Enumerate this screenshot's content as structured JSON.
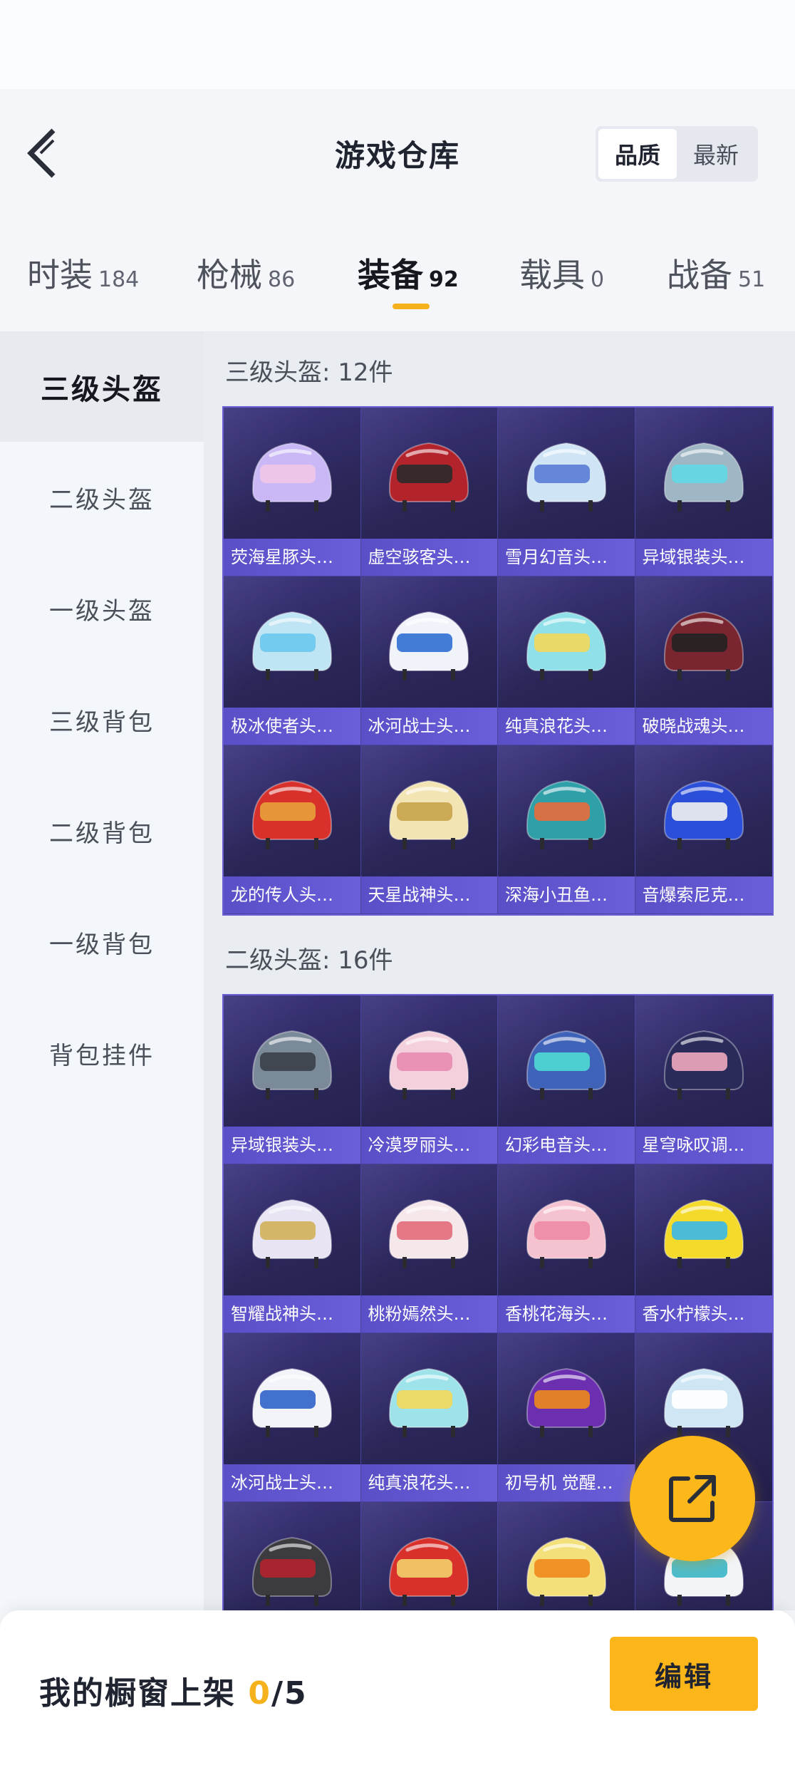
{
  "header": {
    "title": "游戏仓库",
    "sort_options": [
      "品质",
      "最新"
    ],
    "sort_active": "品质"
  },
  "tabs": [
    {
      "label": "时装",
      "count": "184"
    },
    {
      "label": "枪械",
      "count": "86"
    },
    {
      "label": "装备",
      "count": "92"
    },
    {
      "label": "载具",
      "count": "0"
    },
    {
      "label": "战备",
      "count": "51"
    }
  ],
  "active_tab": "装备",
  "sidebar": {
    "items": [
      "三级头盔",
      "二级头盔",
      "一级头盔",
      "三级背包",
      "二级背包",
      "一级背包",
      "背包挂件"
    ],
    "active": "三级头盔"
  },
  "sections": [
    {
      "title": "三级头盔: 12件",
      "items": [
        {
          "name": "荧海星豚头…",
          "color": "#c9b8f5",
          "accent": "#f0c6e8"
        },
        {
          "name": "虚空骇客头…",
          "color": "#b3232c",
          "accent": "#2a2a2a"
        },
        {
          "name": "雪月幻音头…",
          "color": "#cfe5f5",
          "accent": "#5a7bd6"
        },
        {
          "name": "异域银装头…",
          "color": "#9fb6c4",
          "accent": "#5ed9e6"
        },
        {
          "name": "极冰使者头…",
          "color": "#bfe4f4",
          "accent": "#6ac8f0"
        },
        {
          "name": "冰河战士头…",
          "color": "#f0f4fa",
          "accent": "#2f6fd1"
        },
        {
          "name": "纯真浪花头…",
          "color": "#8fe0e8",
          "accent": "#f3d85a"
        },
        {
          "name": "破晓战魂头…",
          "color": "#7a2631",
          "accent": "#222222"
        },
        {
          "name": "龙的传人头…",
          "color": "#d8312c",
          "accent": "#e8a23a"
        },
        {
          "name": "天星战神头…",
          "color": "#f3e4b3",
          "accent": "#c9a34a"
        },
        {
          "name": "深海小丑鱼…",
          "color": "#2f9fa8",
          "accent": "#e86b3a"
        },
        {
          "name": "音爆索尼克…",
          "color": "#2b4fd8",
          "accent": "#f2f2f2"
        }
      ]
    },
    {
      "title": "二级头盔: 16件",
      "items": [
        {
          "name": "异域银装头…",
          "color": "#7b8a99",
          "accent": "#3a3f48"
        },
        {
          "name": "冷漠罗丽头…",
          "color": "#f4d0dd",
          "accent": "#e88bb0"
        },
        {
          "name": "幻彩电音头…",
          "color": "#3f63b8",
          "accent": "#4fd9d4"
        },
        {
          "name": "星穹咏叹调…",
          "color": "#2a2b5a",
          "accent": "#f0a8c0"
        },
        {
          "name": "智耀战神头…",
          "color": "#e8e4f4",
          "accent": "#d2b05a"
        },
        {
          "name": "桃粉嫣然头…",
          "color": "#f6e7ea",
          "accent": "#e36b7a"
        },
        {
          "name": "香桃花海头…",
          "color": "#f5c2cf",
          "accent": "#f08aa5"
        },
        {
          "name": "香水柠檬头…",
          "color": "#f4da2a",
          "accent": "#3ab7e8"
        },
        {
          "name": "冰河战士头…",
          "color": "#f2f4fa",
          "accent": "#2f64c9"
        },
        {
          "name": "纯真浪花头…",
          "color": "#9fe3ea",
          "accent": "#f3d85a"
        },
        {
          "name": "初号机 觉醒…",
          "color": "#6b2fb0",
          "accent": "#f08a1c"
        },
        {
          "name": "",
          "color": "#cfe6f4",
          "accent": "#ffffff"
        },
        {
          "name": "",
          "color": "#3b3b40",
          "accent": "#b3232c"
        },
        {
          "name": "",
          "color": "#d8312c",
          "accent": "#f2d26a"
        },
        {
          "name": "",
          "color": "#f4e07a",
          "accent": "#f08a1c"
        },
        {
          "name": "",
          "color": "#f2f4f7",
          "accent": "#3ab7c8"
        }
      ]
    }
  ],
  "bottom": {
    "shelf_label": "我的橱窗上架",
    "shelf_current": "0",
    "shelf_total": "/5",
    "edit_label": "编辑"
  },
  "colors": {
    "accent": "#fcb81a",
    "tile_bg": "#2e2960",
    "tile_label": "#5a4fc7"
  },
  "icons": {
    "back": "chevron-left-icon",
    "share": "share-external-icon",
    "item": "helmet-icon"
  }
}
